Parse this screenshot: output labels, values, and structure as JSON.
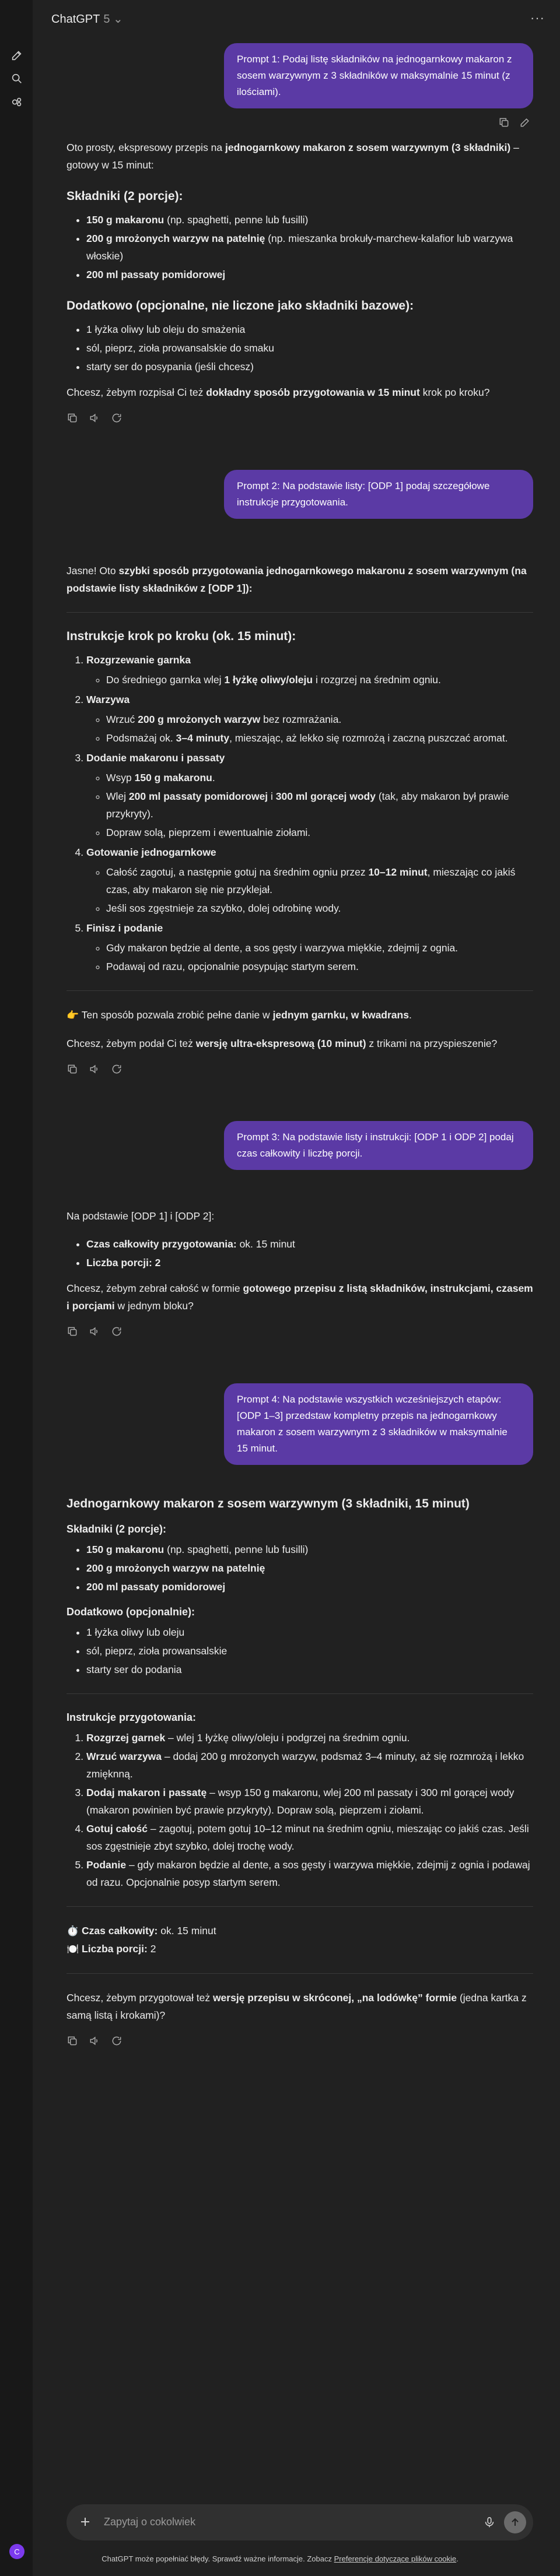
{
  "app": {
    "title": "ChatGPT",
    "version": "5 ⌄",
    "avatar_letter": "C"
  },
  "composer": {
    "placeholder": "Zapytaj o cokolwiek"
  },
  "footer": {
    "note": "ChatGPT może popełniać błędy. Sprawdź ważne informacje. Zobacz",
    "link": "Preferencje dotyczące plików cookie",
    "end": "."
  },
  "colors": {
    "user_bubble": "#5b3aa5",
    "background": "#212121",
    "sidebar": "#181818",
    "composer": "#303030"
  },
  "icons": [
    "new-chat-icon",
    "search-icon",
    "library-icon",
    "copy-icon",
    "edit-icon",
    "read-aloud-icon",
    "regenerate-icon",
    "plus-icon",
    "mic-icon",
    "send-icon",
    "menu-dots-icon"
  ],
  "m1": {
    "user": "Prompt 1: Podaj listę składników na jednogarnkowy makaron z sosem warzywnym z 3 składników w maksymalnie 15 minut (z ilościami)."
  },
  "a1": {
    "intro_1": "Oto prosty, ekspresowy przepis na ",
    "intro_b": "jednogarnkowy makaron z sosem warzywnym (3 składniki)",
    "intro_2": " – gotowy w 15 minut:",
    "h_ingr": "Składniki (2 porcje):",
    "i1b": "150 g makaronu",
    "i1": " (np. spaghetti, penne lub fusilli)",
    "i2b": "200 g mrożonych warzyw na patelnię",
    "i2": " (np. mieszanka brokuły-marchew-kalafior lub warzywa włoskie)",
    "i3b": "200 ml passaty pomidorowej",
    "h_extra": "Dodatkowo (opcjonalne, nie liczone jako składniki bazowe):",
    "e1": "1 łyżka oliwy lub oleju do smażenia",
    "e2": "sól, pieprz, zioła prowansalskie do smaku",
    "e3": "starty ser do posypania (jeśli chcesz)",
    "q_1": "Chcesz, żebym rozpisał Ci też ",
    "q_b": "dokładny sposób przygotowania w 15 minut",
    "q_2": " krok po kroku?"
  },
  "m2": {
    "user": "Prompt 2: Na podstawie listy: [ODP 1] podaj szczegółowe instrukcje przygotowania."
  },
  "a2": {
    "intro_1": "Jasne! Oto ",
    "intro_b": "szybki sposób przygotowania jednogarnkowego makaronu z sosem warzywnym (na podstawie listy składników z [ODP 1]):",
    "h": "Instrukcje krok po kroku (ok. 15 minut):",
    "s1": "Rozgrzewanie garnka",
    "s1a_1": "Do średniego garnka wlej ",
    "s1a_b": "1 łyżkę oliwy/oleju",
    "s1a_2": " i rozgrzej na średnim ogniu.",
    "s2": "Warzywa",
    "s2a_1": "Wrzuć ",
    "s2a_b": "200 g mrożonych warzyw",
    "s2a_2": " bez rozmrażania.",
    "s2b_1": "Podsmażaj ok. ",
    "s2b_b": "3–4 minuty",
    "s2b_2": ", mieszając, aż lekko się rozmrożą i zaczną puszczać aromat.",
    "s3": "Dodanie makaronu i passaty",
    "s3a_1": "Wsyp ",
    "s3a_b": "150 g makaronu",
    "s3a_2": ".",
    "s3b_1": "Wlej ",
    "s3b_b": "200 ml passaty pomidorowej",
    "s3b_m": " i ",
    "s3b_b2": "300 ml gorącej wody",
    "s3b_2": " (tak, aby makaron był prawie przykryty).",
    "s3c": "Dopraw solą, pieprzem i ewentualnie ziołami.",
    "s4": "Gotowanie jednogarnkowe",
    "s4a_1": "Całość zagotuj, a następnie gotuj na średnim ogniu przez ",
    "s4a_b": "10–12 minut",
    "s4a_2": ", mieszając co jakiś czas, aby makaron się nie przyklejał.",
    "s4b": "Jeśli sos zgęstnieje za szybko, dolej odrobinę wody.",
    "s5": "Finisz i podanie",
    "s5a": "Gdy makaron będzie al dente, a sos gęsty i warzywa miękkie, zdejmij z ognia.",
    "s5b": "Podawaj od razu, opcjonalnie posypując startym serem.",
    "note_e": "👉",
    "note_1": " Ten sposób pozwala zrobić pełne danie w ",
    "note_b": "jednym garnku, w kwadrans",
    "note_2": ".",
    "q_1": "Chcesz, żebym podał Ci też ",
    "q_b": "wersję ultra-ekspresową (10 minut)",
    "q_2": " z trikami na przyspieszenie?"
  },
  "m3": {
    "user": "Prompt 3: Na podstawie listy i instrukcji: [ODP 1 i ODP 2] podaj czas całkowity i liczbę porcji."
  },
  "a3": {
    "intro": "Na podstawie [ODP 1] i [ODP 2]:",
    "t_b": "Czas całkowity przygotowania:",
    "t": " ok. 15 minut",
    "p_b": "Liczba porcji: 2",
    "q_1": "Chcesz, żebym zebrał całość w formie ",
    "q_b": "gotowego przepisu z listą składników, instrukcjami, czasem i porcjami",
    "q_2": " w jednym bloku?"
  },
  "m4": {
    "user": "Prompt 4: Na podstawie wszystkich wcześniejszych etapów: [ODP 1–3] przedstaw kompletny przepis na jednogarnkowy makaron z sosem warzywnym z 3 składników w maksymalnie 15 minut."
  },
  "a4": {
    "h": "Jednogarnkowy makaron z sosem warzywnym (3 składniki, 15 minut)",
    "h_ingr": "Składniki (2 porcje):",
    "i1b": "150 g makaronu",
    "i1": " (np. spaghetti, penne lub fusilli)",
    "i2b": "200 g mrożonych warzyw na patelnię",
    "i3b": "200 ml passaty pomidorowej",
    "h_extra": "Dodatkowo (opcjonalnie):",
    "e1": "1 łyżka oliwy lub oleju",
    "e2": "sól, pieprz, zioła prowansalskie",
    "e3": "starty ser do podania",
    "h_steps": "Instrukcje przygotowania:",
    "s1b": "Rozgrzej garnek",
    "s1": " – wlej 1 łyżkę oliwy/oleju i podgrzej na średnim ogniu.",
    "s2b": "Wrzuć warzywa",
    "s2": " – dodaj 200 g mrożonych warzyw, podsmaż 3–4 minuty, aż się rozmrożą i lekko zmięknną.",
    "s3b": "Dodaj makaron i passatę",
    "s3": " – wsyp 150 g makaronu, wlej 200 ml passaty i 300 ml gorącej wody (makaron powinien być prawie przykryty). Dopraw solą, pieprzem i ziołami.",
    "s4b": "Gotuj całość",
    "s4": " – zagotuj, potem gotuj 10–12 minut na średnim ogniu, mieszając co jakiś czas. Jeśli sos zgęstnieje zbyt szybko, dolej trochę wody.",
    "s5b": "Podanie",
    "s5": " – gdy makaron będzie al dente, a sos gęsty i warzywa miękkie, zdejmij z ognia i podawaj od razu. Opcjonalnie posyp startym serem.",
    "time_e": "⏱️",
    "time_b": "Czas całkowity:",
    "time": " ok. 15 minut",
    "portion_e": "🍽️",
    "portion_b": "Liczba porcji:",
    "portion": " 2",
    "q_1": "Chcesz, żebym przygotował też ",
    "q_b": "wersję przepisu w skróconej, „na lodówkę” formie",
    "q_2": " (jedna kartka z samą listą i krokami)?"
  }
}
